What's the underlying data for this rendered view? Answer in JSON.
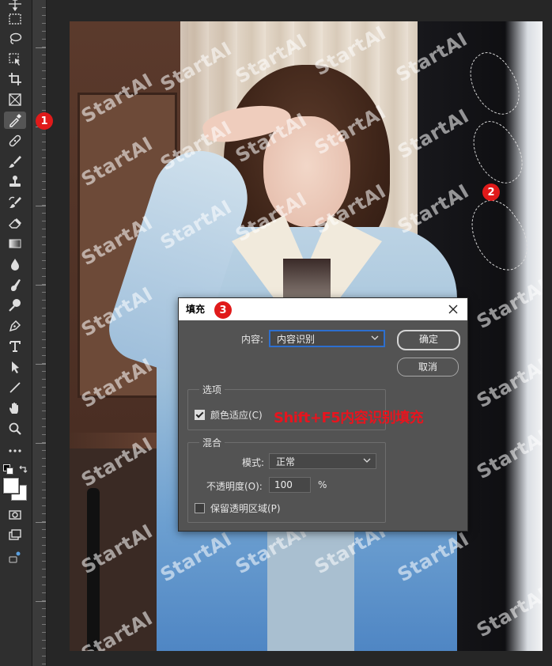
{
  "watermark": "StartAI",
  "tools": [
    {
      "name": "move-icon"
    },
    {
      "name": "marquee-icon"
    },
    {
      "name": "lasso-icon"
    },
    {
      "name": "object-select-icon"
    },
    {
      "name": "crop-icon"
    },
    {
      "name": "frame-icon"
    },
    {
      "name": "eyedropper-icon"
    },
    {
      "name": "healing-brush-icon"
    },
    {
      "name": "brush-icon"
    },
    {
      "name": "clone-stamp-icon"
    },
    {
      "name": "history-brush-icon"
    },
    {
      "name": "eraser-icon"
    },
    {
      "name": "gradient-icon"
    },
    {
      "name": "blur-icon"
    },
    {
      "name": "smudge-icon"
    },
    {
      "name": "dodge-icon"
    },
    {
      "name": "pen-icon"
    },
    {
      "name": "type-icon"
    },
    {
      "name": "path-select-icon"
    },
    {
      "name": "line-icon"
    },
    {
      "name": "hand-icon"
    },
    {
      "name": "zoom-icon"
    },
    {
      "name": "more-tools-icon"
    }
  ],
  "badges": {
    "one": "1",
    "two": "2",
    "three": "3"
  },
  "colors": {
    "foreground": "#ffffff",
    "background": "#ffffff",
    "badge": "#e01a1a",
    "annotation": "#e8141e"
  },
  "dialog": {
    "title": "填充",
    "content_label": "内容:",
    "content_value": "内容识别",
    "ok_label": "确定",
    "cancel_label": "取消",
    "options_title": "选项",
    "color_adapt_label": "颜色适应(C)",
    "color_adapt_checked": true,
    "blend_title": "混合",
    "mode_label": "模式:",
    "mode_value": "正常",
    "opacity_label": "不透明度(O):",
    "opacity_value": "100",
    "opacity_unit": "%",
    "preserve_label": "保留透明区域(P)",
    "preserve_checked": false
  },
  "annotation": "Shift+F5内容识别填充"
}
